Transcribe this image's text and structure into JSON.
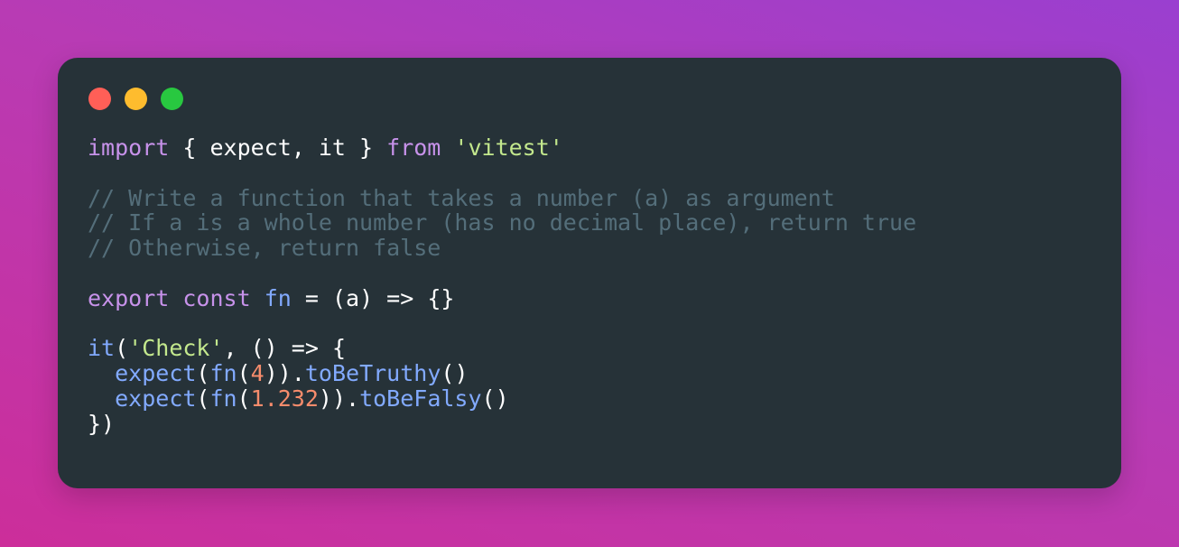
{
  "window": {
    "traffic_lights": [
      {
        "name": "close",
        "color": "#ff5f57"
      },
      {
        "name": "minimize",
        "color": "#febc2e"
      },
      {
        "name": "zoom",
        "color": "#28c840"
      }
    ]
  },
  "colors": {
    "background_start": "#9a3fd0",
    "background_end": "#cc2e9a",
    "panel": "#263238",
    "keyword": "#c792ea",
    "string": "#c3e88d",
    "comment": "#546e7a",
    "function": "#82aaff",
    "number": "#f78c6c",
    "plain": "#ffffff"
  },
  "code": {
    "lines": [
      [
        {
          "t": "keyword",
          "v": "import"
        },
        {
          "t": "plain",
          "v": " { expect, it } "
        },
        {
          "t": "keyword",
          "v": "from"
        },
        {
          "t": "plain",
          "v": " "
        },
        {
          "t": "string",
          "v": "'vitest'"
        }
      ],
      [],
      [
        {
          "t": "comment",
          "v": "// Write a function that takes a number (a) as argument"
        }
      ],
      [
        {
          "t": "comment",
          "v": "// If a is a whole number (has no decimal place), return true"
        }
      ],
      [
        {
          "t": "comment",
          "v": "// Otherwise, return false"
        }
      ],
      [],
      [
        {
          "t": "keyword",
          "v": "export"
        },
        {
          "t": "plain",
          "v": " "
        },
        {
          "t": "keyword",
          "v": "const"
        },
        {
          "t": "plain",
          "v": " "
        },
        {
          "t": "func",
          "v": "fn"
        },
        {
          "t": "plain",
          "v": " = (a) => {}"
        }
      ],
      [],
      [
        {
          "t": "func",
          "v": "it"
        },
        {
          "t": "plain",
          "v": "("
        },
        {
          "t": "string",
          "v": "'Check'"
        },
        {
          "t": "plain",
          "v": ", () => {"
        }
      ],
      [
        {
          "t": "plain",
          "v": "  "
        },
        {
          "t": "func",
          "v": "expect"
        },
        {
          "t": "plain",
          "v": "("
        },
        {
          "t": "func",
          "v": "fn"
        },
        {
          "t": "plain",
          "v": "("
        },
        {
          "t": "number",
          "v": "4"
        },
        {
          "t": "plain",
          "v": "))."
        },
        {
          "t": "func",
          "v": "toBeTruthy"
        },
        {
          "t": "plain",
          "v": "()"
        }
      ],
      [
        {
          "t": "plain",
          "v": "  "
        },
        {
          "t": "func",
          "v": "expect"
        },
        {
          "t": "plain",
          "v": "("
        },
        {
          "t": "func",
          "v": "fn"
        },
        {
          "t": "plain",
          "v": "("
        },
        {
          "t": "number",
          "v": "1.232"
        },
        {
          "t": "plain",
          "v": "))."
        },
        {
          "t": "func",
          "v": "toBeFalsy"
        },
        {
          "t": "plain",
          "v": "()"
        }
      ],
      [
        {
          "t": "plain",
          "v": "})"
        }
      ]
    ]
  }
}
